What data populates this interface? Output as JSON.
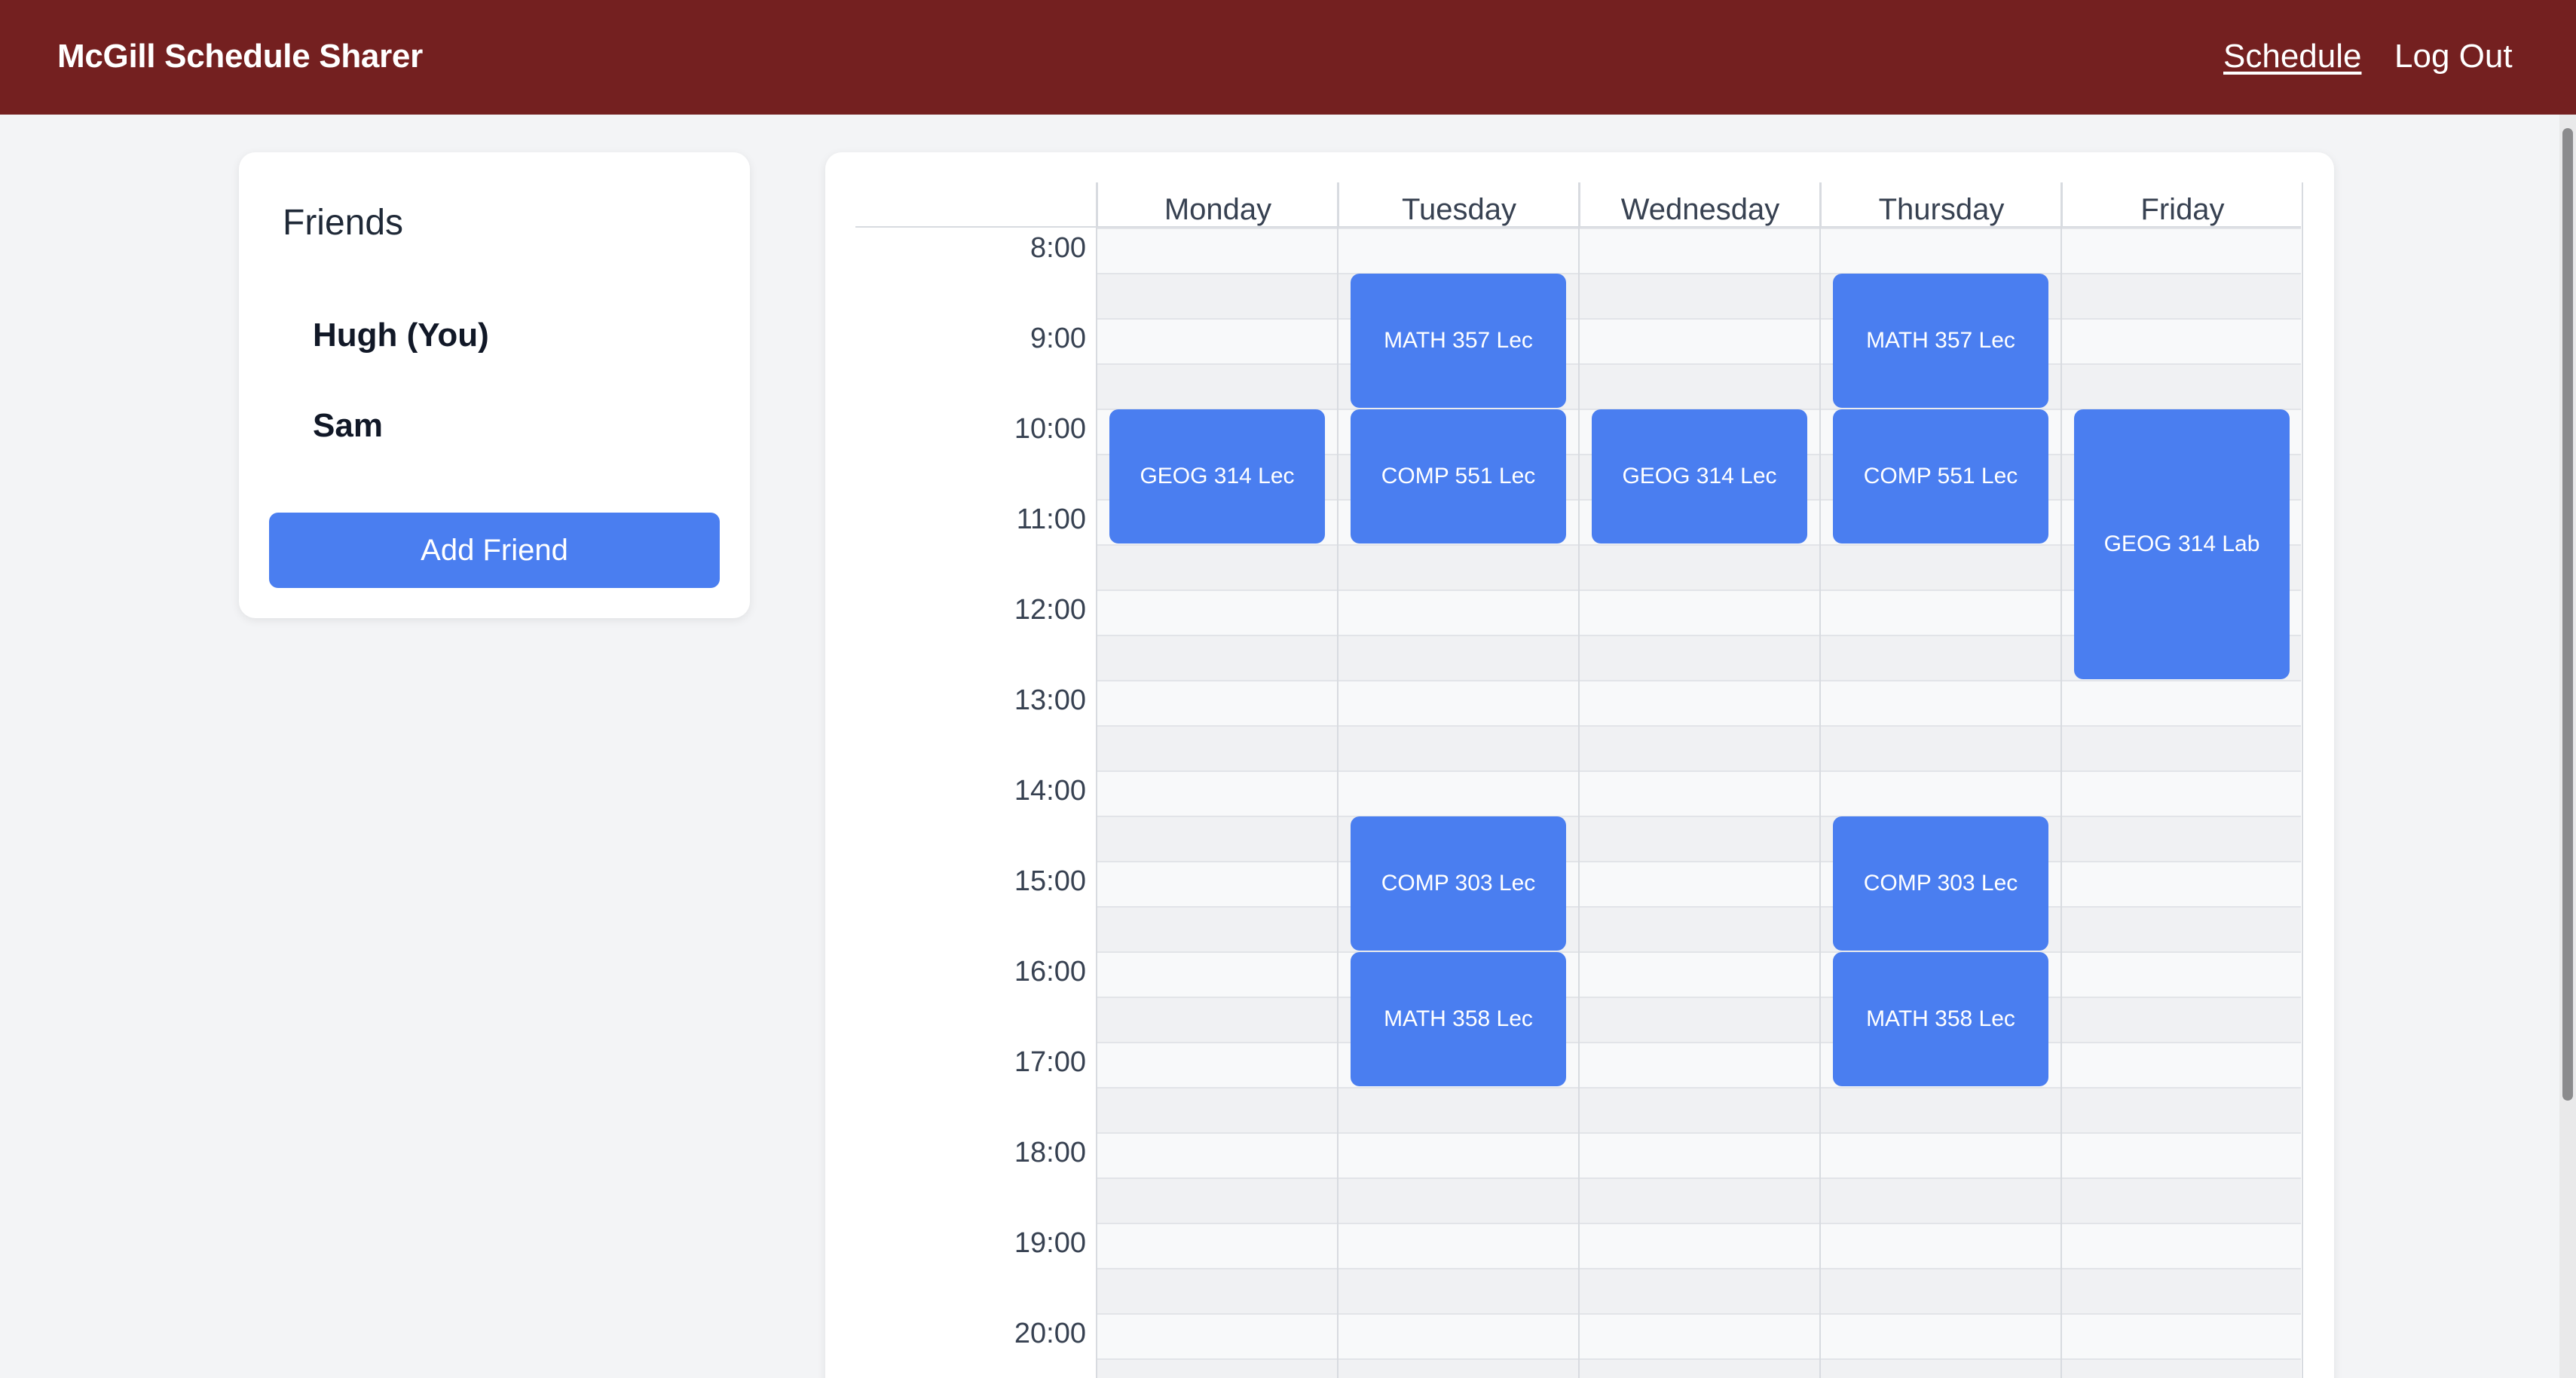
{
  "header": {
    "brand": "McGill Schedule Sharer",
    "nav": {
      "schedule": "Schedule",
      "logout": "Log Out"
    },
    "color": "#742020"
  },
  "friends": {
    "title": "Friends",
    "items": [
      {
        "label": "Hugh (You)"
      },
      {
        "label": "Sam"
      }
    ],
    "add_button": "Add Friend"
  },
  "schedule": {
    "days": [
      "Monday",
      "Tuesday",
      "Wednesday",
      "Thursday",
      "Friday"
    ],
    "hours": [
      "8:00",
      "9:00",
      "10:00",
      "11:00",
      "12:00",
      "13:00",
      "14:00",
      "15:00",
      "16:00",
      "17:00",
      "18:00",
      "19:00",
      "20:00"
    ],
    "event_color": "#4a7ef0",
    "events": [
      {
        "day": "Tuesday",
        "label": "MATH 357 Lec",
        "start": "8:30",
        "end": "10:00"
      },
      {
        "day": "Thursday",
        "label": "MATH 357 Lec",
        "start": "8:30",
        "end": "10:00"
      },
      {
        "day": "Monday",
        "label": "GEOG 314 Lec",
        "start": "10:00",
        "end": "11:30"
      },
      {
        "day": "Tuesday",
        "label": "COMP 551 Lec",
        "start": "10:00",
        "end": "11:30"
      },
      {
        "day": "Wednesday",
        "label": "GEOG 314 Lec",
        "start": "10:00",
        "end": "11:30"
      },
      {
        "day": "Thursday",
        "label": "COMP 551 Lec",
        "start": "10:00",
        "end": "11:30"
      },
      {
        "day": "Friday",
        "label": "GEOG 314 Lab",
        "start": "10:00",
        "end": "13:00"
      },
      {
        "day": "Tuesday",
        "label": "COMP 303 Lec",
        "start": "14:30",
        "end": "16:00"
      },
      {
        "day": "Thursday",
        "label": "COMP 303 Lec",
        "start": "14:30",
        "end": "16:00"
      },
      {
        "day": "Tuesday",
        "label": "MATH 358 Lec",
        "start": "16:00",
        "end": "17:30"
      },
      {
        "day": "Thursday",
        "label": "MATH 358 Lec",
        "start": "16:00",
        "end": "17:30"
      }
    ]
  }
}
